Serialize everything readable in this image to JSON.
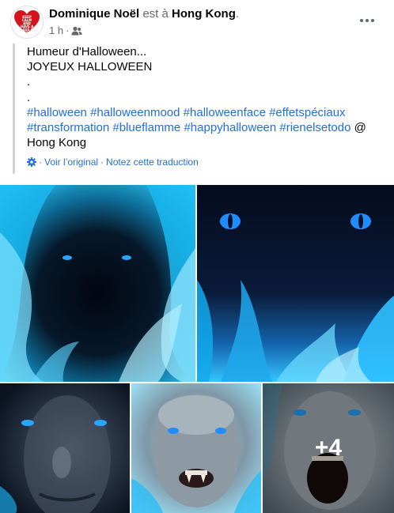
{
  "post": {
    "author": "Dominique Noël",
    "location_prefix": "est à",
    "location": "Hong Kong",
    "location_suffix": ".",
    "time": "1 h",
    "time_sep": "·",
    "audience_icon": "friends-icon",
    "more_icon": "more-horizontal-icon",
    "avatar_text": "KEEP\nCALM\nAND\nHAVE A\nGLASS OF\nWINE",
    "text_lines": [
      "Humeur d'Halloween...",
      "JOYEUX HALLOWEEN",
      ".",
      "."
    ],
    "hashtags_line1": [
      "#halloween",
      "#halloweenmood",
      "#halloweenface",
      "#effetspéciaux"
    ],
    "hashtags_line2": [
      "#transformation",
      "#blueflamme",
      "#happyhalloween",
      "#rienelsetodo"
    ],
    "at_sign": "@",
    "place_text": "Hong Kong",
    "translation": {
      "gear_icon": "gear-icon",
      "sep1": "·",
      "see_original": "Voir l’original",
      "sep2": "·",
      "rate": "Notez cette traduction"
    }
  },
  "photos": {
    "more_count": "+4",
    "items": [
      {
        "name": "blue-flame-face-eyes",
        "alt": "Visage sombre entouré de flammes bleues"
      },
      {
        "name": "blue-flame-cat-eyes",
        "alt": "Yeux bleus lumineux dans des flammes bleues"
      },
      {
        "name": "face-glowing-eyes",
        "alt": "Visage avec yeux bleus lumineux"
      },
      {
        "name": "face-fangs",
        "alt": "Visage avec crocs et yeux bleus"
      },
      {
        "name": "face-screaming",
        "alt": "Visage qui crie avec yeux bleus"
      }
    ]
  },
  "colors": {
    "link": "#216fdb",
    "muted": "#65676b",
    "flame_cyan": "#14c8ff",
    "flame_light": "#9be8ff",
    "eye_blue": "#27a5ff"
  }
}
